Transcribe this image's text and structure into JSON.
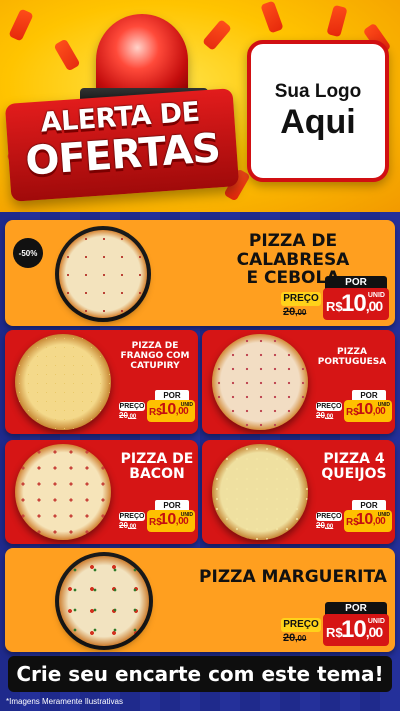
{
  "header": {
    "alert_line1": "ALERTA DE",
    "alert_line2": "OFERTAS",
    "logo_line1": "Sua Logo",
    "logo_line2": "Aqui"
  },
  "colors": {
    "yellow": "#ffc400",
    "red": "#d61515",
    "orange": "#ff9f1f",
    "navy": "#1f2a8c"
  },
  "labels": {
    "preco": "PREÇO",
    "por": "POR",
    "unid": "UNID",
    "currency": "R$"
  },
  "products": [
    {
      "name_line1": "PIZZA DE CALABRESA",
      "name_line2": "E CEBOLA",
      "badge": "-50%",
      "old_price": "20",
      "old_cents": ",00",
      "price": "10",
      "cents": ",00"
    },
    {
      "name_line1": "PIZZA DE",
      "name_line2": "FRANGO COM",
      "name_line3": "CATUPIRY",
      "old_price": "20",
      "old_cents": ",00",
      "price": "10",
      "cents": ",00"
    },
    {
      "name_line1": "PIZZA",
      "name_line2": "PORTUGUESA",
      "old_price": "20",
      "old_cents": ",00",
      "price": "10",
      "cents": ",00"
    },
    {
      "name_line1": "PIZZA DE",
      "name_line2": "BACON",
      "old_price": "20",
      "old_cents": ",00",
      "price": "10",
      "cents": ",00"
    },
    {
      "name_line1": "PIZZA 4",
      "name_line2": "QUEIJOS",
      "old_price": "20",
      "old_cents": ",00",
      "price": "10",
      "cents": ",00"
    },
    {
      "name_line1": "PIZZA MARGUERITA",
      "old_price": "20",
      "old_cents": ",00",
      "price": "10",
      "cents": ",00"
    }
  ],
  "footer": {
    "cta": "Crie seu encarte com este tema!",
    "disclaimer": "*Imagens Meramente Ilustrativas"
  }
}
